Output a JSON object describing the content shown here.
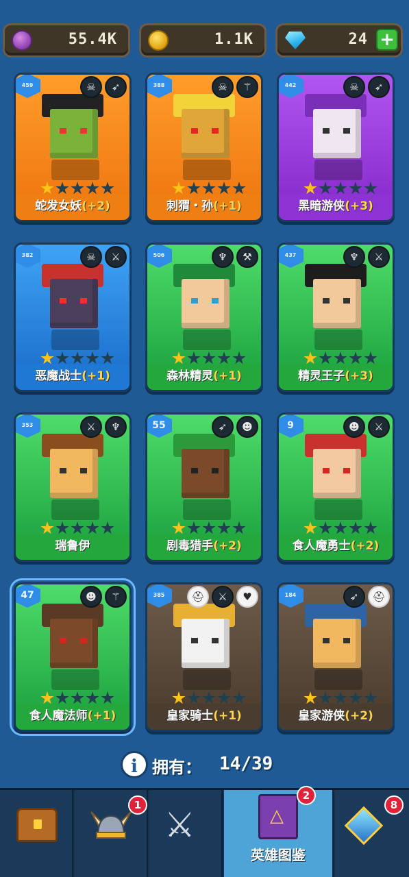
{
  "currencies": {
    "purple": {
      "icon": "purple-coin-icon",
      "value": "55.4K"
    },
    "gold": {
      "icon": "gold-coin-icon",
      "value": "1.1K"
    },
    "gems": {
      "icon": "gem-icon",
      "value": "24",
      "add_label": "+"
    }
  },
  "heroes": [
    {
      "level": "459",
      "name": "蛇发女妖",
      "plus": "(+2)",
      "stars": 1,
      "theme": "orange",
      "roles": [
        "skull-role-icon",
        "bow-role-icon"
      ]
    },
    {
      "level": "388",
      "name": "刺猬・孙",
      "plus": "(+1)",
      "stars": 1,
      "theme": "orange",
      "roles": [
        "skull-role-icon",
        "wand-role-icon"
      ]
    },
    {
      "level": "442",
      "name": "黑暗游侠",
      "plus": "(+3)",
      "stars": 1,
      "theme": "purple",
      "roles": [
        "skull-role-icon",
        "bow-role-icon"
      ]
    },
    {
      "level": "382",
      "name": "恶魔战士",
      "plus": "(+1)",
      "stars": 1,
      "theme": "blue",
      "roles": [
        "skull-role-icon",
        "sword-role-icon"
      ]
    },
    {
      "level": "506",
      "name": "森林精灵",
      "plus": "(+1)",
      "stars": 1,
      "theme": "green",
      "roles": [
        "elf-role-icon",
        "hammer-role-icon"
      ]
    },
    {
      "level": "437",
      "name": "精灵王子",
      "plus": "(+3)",
      "stars": 1,
      "theme": "green",
      "roles": [
        "elf-role-icon",
        "sword-role-icon"
      ]
    },
    {
      "level": "353",
      "name": "瑞鲁伊",
      "plus": "",
      "stars": 1,
      "theme": "green",
      "roles": [
        "sword-role-icon",
        "elf-role-icon"
      ]
    },
    {
      "level": "55",
      "name": "剧毒猎手",
      "plus": "(+2)",
      "stars": 1,
      "theme": "green",
      "roles": [
        "bow-role-icon",
        "orc-role-icon"
      ]
    },
    {
      "level": "9",
      "name": "食人魔勇士",
      "plus": "(+2)",
      "stars": 1,
      "theme": "green",
      "roles": [
        "orc-role-icon",
        "sword-role-icon"
      ]
    },
    {
      "level": "47",
      "name": "食人魔法师",
      "plus": "(+1)",
      "stars": 1,
      "theme": "green",
      "roles": [
        "orc-role-icon",
        "wand-role-icon"
      ]
    },
    {
      "level": "385",
      "name": "皇家骑士",
      "plus": "(+1)",
      "stars": 1,
      "theme": "brown",
      "roles": [
        "helmet-role-icon",
        "sword-role-icon",
        "heart-role-icon"
      ]
    },
    {
      "level": "184",
      "name": "皇家游侠",
      "plus": "(+2)",
      "stars": 1,
      "theme": "brown",
      "roles": [
        "bow-role-icon",
        "helmet-role-icon"
      ]
    }
  ],
  "owned": {
    "label": "拥有：",
    "value": "14/39"
  },
  "nav": {
    "tabs": [
      {
        "name": "chest",
        "label": "",
        "badge": ""
      },
      {
        "name": "heroes-helmet",
        "label": "",
        "badge": "1"
      },
      {
        "name": "battle",
        "label": "",
        "badge": ""
      },
      {
        "name": "hero-codex",
        "label": "英雄图鉴",
        "badge": "2"
      },
      {
        "name": "equipment",
        "label": "",
        "badge": "8"
      }
    ]
  },
  "colors": {
    "background": "#1f5a94",
    "orange": "#f58d1f",
    "purple": "#9a3fd6",
    "blue": "#2a8ee0",
    "green": "#2fbf4c",
    "brown": "#5b4a3a",
    "plus": "#ffd447"
  }
}
